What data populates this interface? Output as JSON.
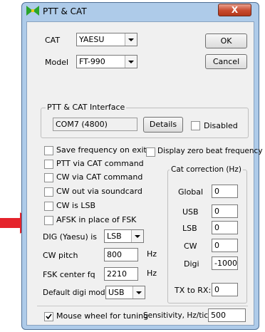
{
  "window": {
    "title": "PTT & CAT",
    "close_glyph": "X"
  },
  "cat": {
    "label": "CAT",
    "value": "YAESU"
  },
  "model": {
    "label": "Model",
    "value": "FT-990"
  },
  "buttons": {
    "ok": "OK",
    "cancel": "Cancel"
  },
  "interface": {
    "title": "PTT & CAT Interface",
    "port": "COM7 (4800)",
    "details": "Details",
    "disabled": "Disabled"
  },
  "checks": {
    "save_freq": "Save frequency on exit",
    "display_zero": "Display zero beat frequency",
    "ptt_cat": "PTT via CAT command",
    "cw_cat": "CW via CAT command",
    "cw_sound": "CW out via soundcard",
    "cw_lsb": "CW is LSB",
    "afsk": "AFSK in place of FSK",
    "mouse_wheel": "Mouse wheel for tuning",
    "mouse_wheel_checked": true
  },
  "dig": {
    "label": "DIG (Yaesu) is",
    "value": "LSB"
  },
  "cw_pitch": {
    "label": "CW pitch",
    "value": "800",
    "unit": "Hz"
  },
  "fsk_center": {
    "label": "FSK center fq",
    "value": "2210",
    "unit": "Hz"
  },
  "default_digi": {
    "label": "Default digi mode",
    "value": "USB"
  },
  "correction": {
    "title": "Cat correction (Hz)",
    "global": {
      "label": "Global",
      "value": "0"
    },
    "usb": {
      "label": "USB",
      "value": "0"
    },
    "lsb": {
      "label": "LSB",
      "value": "0"
    },
    "cw": {
      "label": "CW",
      "value": "0"
    },
    "digi": {
      "label": "Digi",
      "value": "-1000"
    },
    "tx_rx": {
      "label": "TX to RX:",
      "value": "0"
    }
  },
  "sensitivity": {
    "label": "Sensitivity, Hz/tick",
    "value": "500"
  },
  "colors": {
    "arrow": "#e5232b",
    "window_frame": "#aecbe9",
    "close_button": "#c84a2e"
  }
}
